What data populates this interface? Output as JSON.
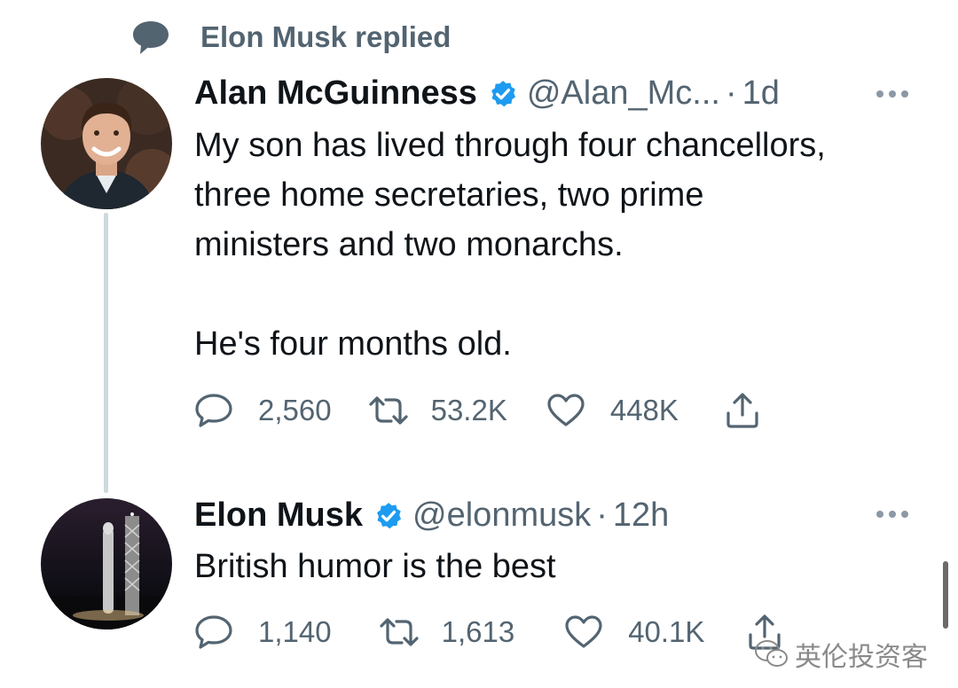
{
  "social_context": {
    "icon": "speech-bubble-icon",
    "label": "Elon Musk replied"
  },
  "tweets": [
    {
      "name": "Alan McGuinness",
      "verified": true,
      "handle": "@Alan_Mc...",
      "separator": "·",
      "time": "1d",
      "text": "My son has lived through four chancellors,\nthree home secretaries, two prime\nministers and two monarchs.\n\nHe's four months old.",
      "stats": {
        "replies": "2,560",
        "retweets": "53.2K",
        "likes": "448K"
      }
    },
    {
      "name": "Elon Musk",
      "verified": true,
      "handle": "@elonmusk",
      "separator": "·",
      "time": "12h",
      "text": "British humor is the best",
      "stats": {
        "replies": "1,140",
        "retweets": "1,613",
        "likes": "40.1K"
      }
    }
  ],
  "watermark": {
    "text": "英伦投资客"
  },
  "colors": {
    "verified": "#1d9bf0",
    "secondary_text": "#536471",
    "primary_text": "#0f1419",
    "thread_line": "#cfd9de"
  }
}
